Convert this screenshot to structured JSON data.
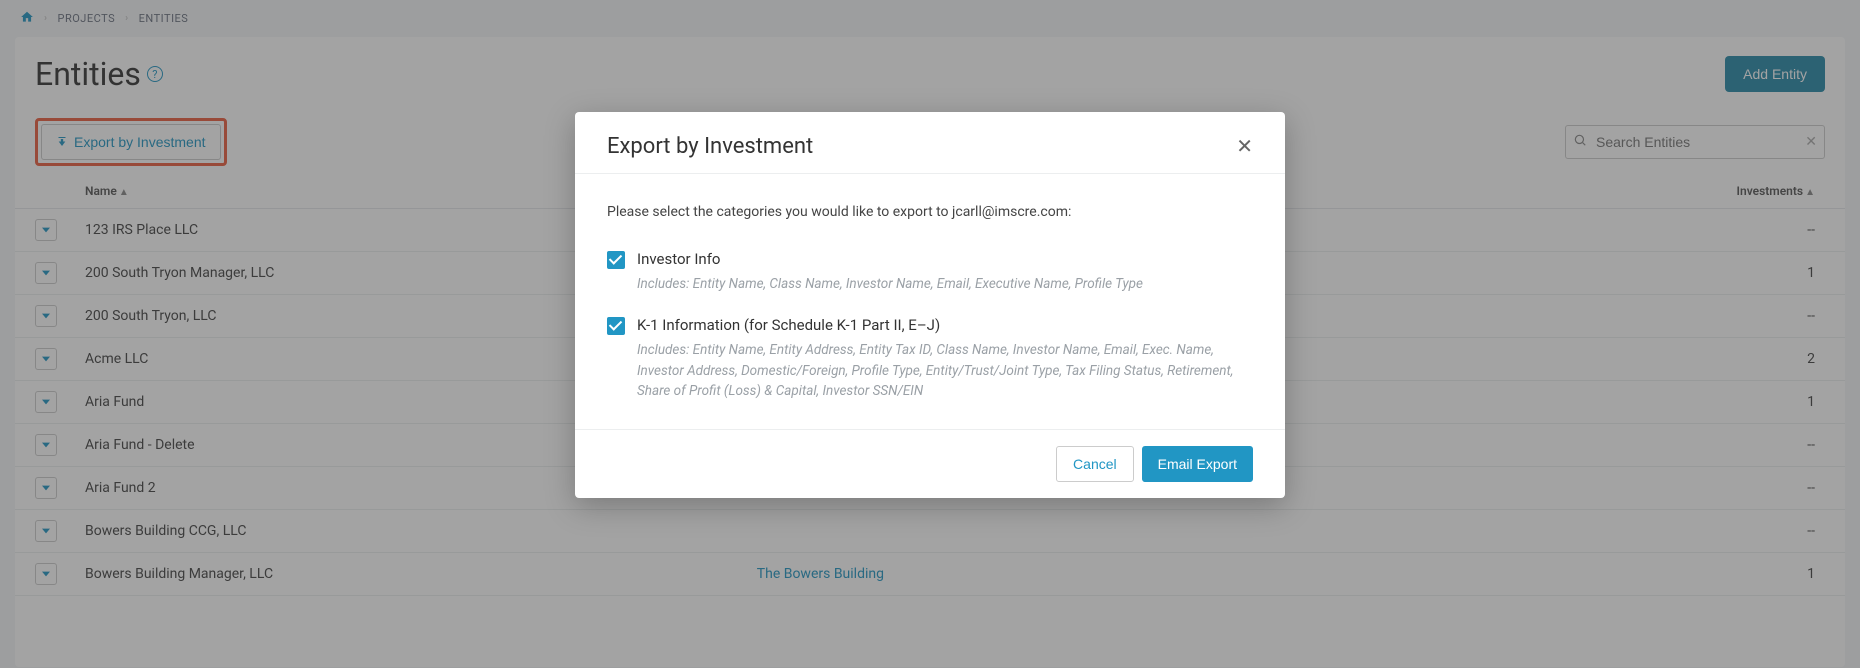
{
  "breadcrumb": {
    "items": [
      "PROJECTS",
      "ENTITIES"
    ]
  },
  "page": {
    "title": "Entities",
    "add_button": "Add Entity",
    "export_button": "Export by Investment",
    "search_placeholder": "Search Entities"
  },
  "table": {
    "columns": {
      "name": "Name",
      "investments": "Investments"
    },
    "rows": [
      {
        "name": "123 IRS Place LLC",
        "middle": "",
        "investments": "--"
      },
      {
        "name": "200 South Tryon Manager, LLC",
        "middle": "",
        "investments": "1"
      },
      {
        "name": "200 South Tryon, LLC",
        "middle": "",
        "investments": "--"
      },
      {
        "name": "Acme LLC",
        "middle": "",
        "investments": "2"
      },
      {
        "name": "Aria Fund",
        "middle": "",
        "investments": "1"
      },
      {
        "name": "Aria Fund - Delete",
        "middle": "",
        "investments": "--"
      },
      {
        "name": "Aria Fund 2",
        "middle": "",
        "investments": "--"
      },
      {
        "name": "Bowers Building CCG, LLC",
        "middle": "",
        "investments": "--"
      },
      {
        "name": "Bowers Building Manager, LLC",
        "middle": "The Bowers Building",
        "investments": "1"
      }
    ]
  },
  "modal": {
    "title": "Export by Investment",
    "intro": "Please select the categories you would like to export to jcarll@imscre.com:",
    "categories": [
      {
        "label": "Investor Info",
        "checked": true,
        "description": "Includes: Entity Name, Class Name, Investor Name, Email, Executive Name, Profile Type"
      },
      {
        "label": "K-1 Information (for Schedule K-1 Part II, E–J)",
        "checked": true,
        "description": "Includes: Entity Name, Entity Address, Entity Tax ID, Class Name, Investor Name, Email, Exec. Name, Investor Address, Domestic/Foreign, Profile Type, Entity/Trust/Joint Type, Tax Filing Status, Retirement, Share of Profit (Loss) & Capital, Investor SSN/EIN"
      }
    ],
    "cancel": "Cancel",
    "submit": "Email Export"
  }
}
